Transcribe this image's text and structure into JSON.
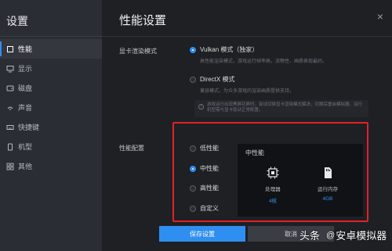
{
  "sidebar": {
    "title": "设置",
    "items": [
      {
        "label": "性能",
        "icon": "square-icon",
        "active": true
      },
      {
        "label": "显示",
        "icon": "monitor-icon",
        "active": false
      },
      {
        "label": "磁盘",
        "icon": "disk-icon",
        "active": false
      },
      {
        "label": "声音",
        "icon": "sound-icon",
        "active": false
      },
      {
        "label": "快捷键",
        "icon": "keyboard-icon",
        "active": false
      },
      {
        "label": "机型",
        "icon": "phone-icon",
        "active": false
      },
      {
        "label": "其他",
        "icon": "grid-icon",
        "active": false
      }
    ]
  },
  "main": {
    "title": "性能设置",
    "close_glyph": "×",
    "render_mode": {
      "label": "显卡渲染模式",
      "options": [
        {
          "label": "Vulkan 模式（独家）",
          "desc": "高性能渲染模式，游戏运行帧率高，流畅性、画质表现最好。",
          "selected": true
        },
        {
          "label": "DirectX 模式",
          "desc": "兼容模式，为众多游戏的渲染画质提供支持。",
          "selected": false
        }
      ],
      "tip": "游戏运行出现黑屏花屏时，尝试切换显卡渲染模式解决，切换后重启模拟器，运行机型需与显卡驱动正常配置。",
      "tip_icon": "i"
    },
    "performance": {
      "label": "性能配置",
      "options": [
        {
          "label": "低性能",
          "selected": false
        },
        {
          "label": "中性能",
          "selected": true
        },
        {
          "label": "高性能",
          "selected": false
        },
        {
          "label": "自定义",
          "selected": false
        }
      ],
      "card": {
        "title": "中性能",
        "cpu_label": "处理器",
        "cpu_value": "4核",
        "ram_label": "运行内存",
        "ram_value": "4GB"
      }
    },
    "save_label": "保存设置",
    "cancel_label": "取消"
  },
  "watermark": {
    "brand": "头条",
    "at": "@",
    "account": "安卓模拟器"
  },
  "colors": {
    "accent": "#2f8ff0",
    "highlight": "#e0232a"
  }
}
